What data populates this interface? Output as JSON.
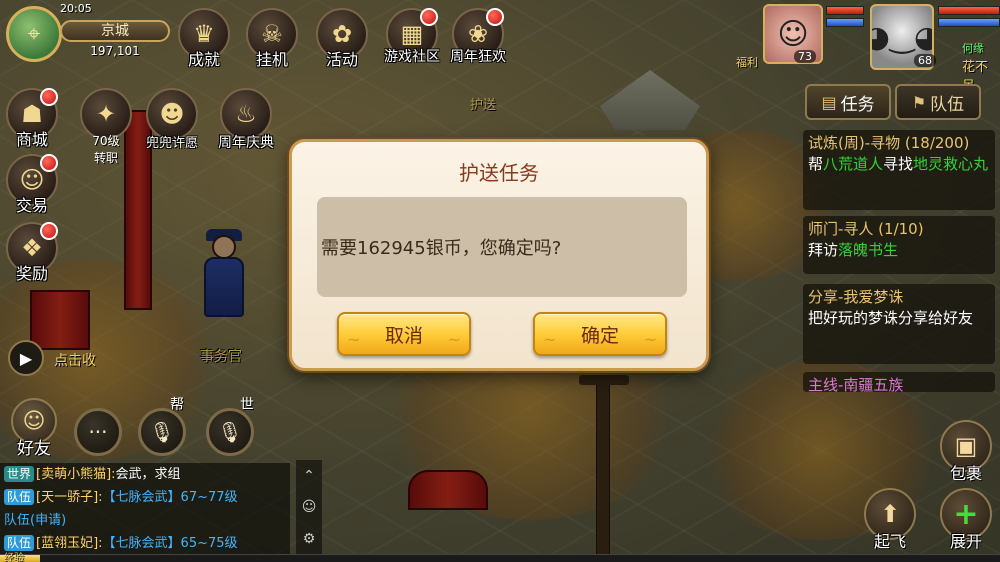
{
  "status": {
    "time": "20:05",
    "wifi_icon": "wifi-icon"
  },
  "location": {
    "name": "京城",
    "coords": "197,101"
  },
  "top_icons": [
    {
      "label": "成就",
      "icon": "trophy-icon",
      "dot": false
    },
    {
      "label": "挂机",
      "icon": "skull-mask-icon",
      "dot": false
    },
    {
      "label": "活动",
      "icon": "lion-dance-icon",
      "dot": false
    },
    {
      "label": "游戏社区",
      "icon": "community-icon",
      "dot": true
    },
    {
      "label": "周年狂欢",
      "icon": "cat-mascot-icon",
      "dot": true
    }
  ],
  "second_row_icons": [
    {
      "label": "70级",
      "sub": "转职",
      "icon": "level-up-icon"
    },
    {
      "label": "兜兜许愿",
      "icon": "wish-icon"
    },
    {
      "label": "周年庆典",
      "icon": "cake-icon"
    }
  ],
  "left_icons": [
    {
      "label": "商城",
      "icon": "shop-icon",
      "dot": true
    },
    {
      "label": "交易",
      "icon": "lucky-cat-icon",
      "dot": true
    },
    {
      "label": "奖励",
      "icon": "gift-icon",
      "dot": true
    }
  ],
  "world": {
    "npc_name": "事务官",
    "escort_label": "护送"
  },
  "portraits": {
    "pet": {
      "level": "73",
      "tag": "福利"
    },
    "player": {
      "level": "68",
      "name_partial": "花不吊",
      "partial_top": "何缘"
    }
  },
  "quest_tabs": [
    {
      "label": "任务",
      "icon": "scroll-icon"
    },
    {
      "label": "队伍",
      "icon": "team-icon"
    }
  ],
  "quests": [
    {
      "title": "试炼(周)-寻物 (18/200)",
      "desc_prefix": "帮",
      "desc_npc": "八荒道人",
      "desc_mid": "寻找",
      "desc_item": "地灵救心丸"
    },
    {
      "title": "师门-寻人 (1/10)",
      "desc_prefix": "拜访",
      "desc_npc": "落魄书生"
    },
    {
      "title": "分享-我爱梦诛",
      "desc": "把好玩的梦诛分享给好友"
    },
    {
      "title": "主线-南疆五族"
    }
  ],
  "left_bottom": {
    "click_hint": "点击收",
    "friend_label": "好友",
    "bang_label": "帮",
    "shi_label": "世"
  },
  "chat": [
    {
      "channel": "世界",
      "who": "[卖萌小熊猫]:",
      "msg": "会武，求组",
      "type": "world"
    },
    {
      "channel": "队伍",
      "who": "[天一骄子]:",
      "msg": "【七脉会武】67~77级",
      "type": "team"
    },
    {
      "channel": "队伍",
      "who": "",
      "msg": "(申请)",
      "type": "team-plain"
    },
    {
      "channel": "队伍",
      "who": "[蓝翎玉妃]:",
      "msg": "【七脉会武】65~75级",
      "type": "team"
    }
  ],
  "bottom_right": {
    "bag_label": "包裹",
    "fly_label": "起飞",
    "expand_label": "展开"
  },
  "exp": {
    "label": "经验",
    "percent": 4
  },
  "dialog": {
    "title": "护送任务",
    "message": "需要162945银币，您确定吗?",
    "cancel_label": "取消",
    "confirm_label": "确定"
  }
}
